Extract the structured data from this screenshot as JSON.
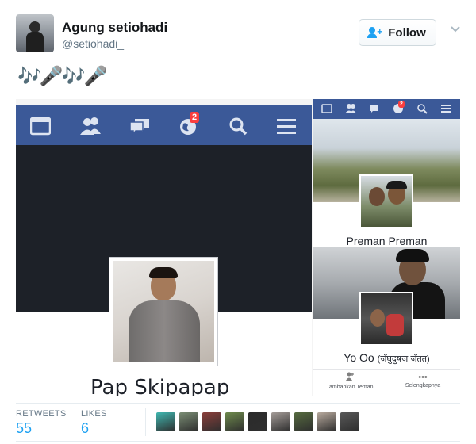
{
  "tweet": {
    "author_name": "Agung setiohadi",
    "author_handle": "@setiohadi_",
    "follow_label": "Follow",
    "text": "🎶🎤🎶🎤"
  },
  "media": {
    "profile_name": "Pap Skipapap",
    "notification_count": "2",
    "right_notification_count": "2",
    "friends": [
      {
        "name": "Preman Preman"
      },
      {
        "name": "Yo Oo",
        "sub": "(जॅघुदुषज जॅतत)"
      }
    ],
    "actions": [
      {
        "label": "Tambahkan Teman",
        "icon": "add-friend-icon"
      },
      {
        "label": "Selengkapnya",
        "icon": "more-icon"
      }
    ]
  },
  "stats": {
    "retweets_label": "RETWEETS",
    "retweets_count": "55",
    "likes_label": "LIKES",
    "likes_count": "6",
    "liker_colors": [
      "#3fb7b0",
      "#7a8d74",
      "#8a3e3a",
      "#6e8a4c",
      "#2b2b2b",
      "#a39b97",
      "#566b3f",
      "#b7a99d",
      "#585858"
    ]
  },
  "colors": {
    "facebook_blue": "#3b5998",
    "twitter_blue": "#1da1f2",
    "badge_red": "#fa3e3e"
  }
}
